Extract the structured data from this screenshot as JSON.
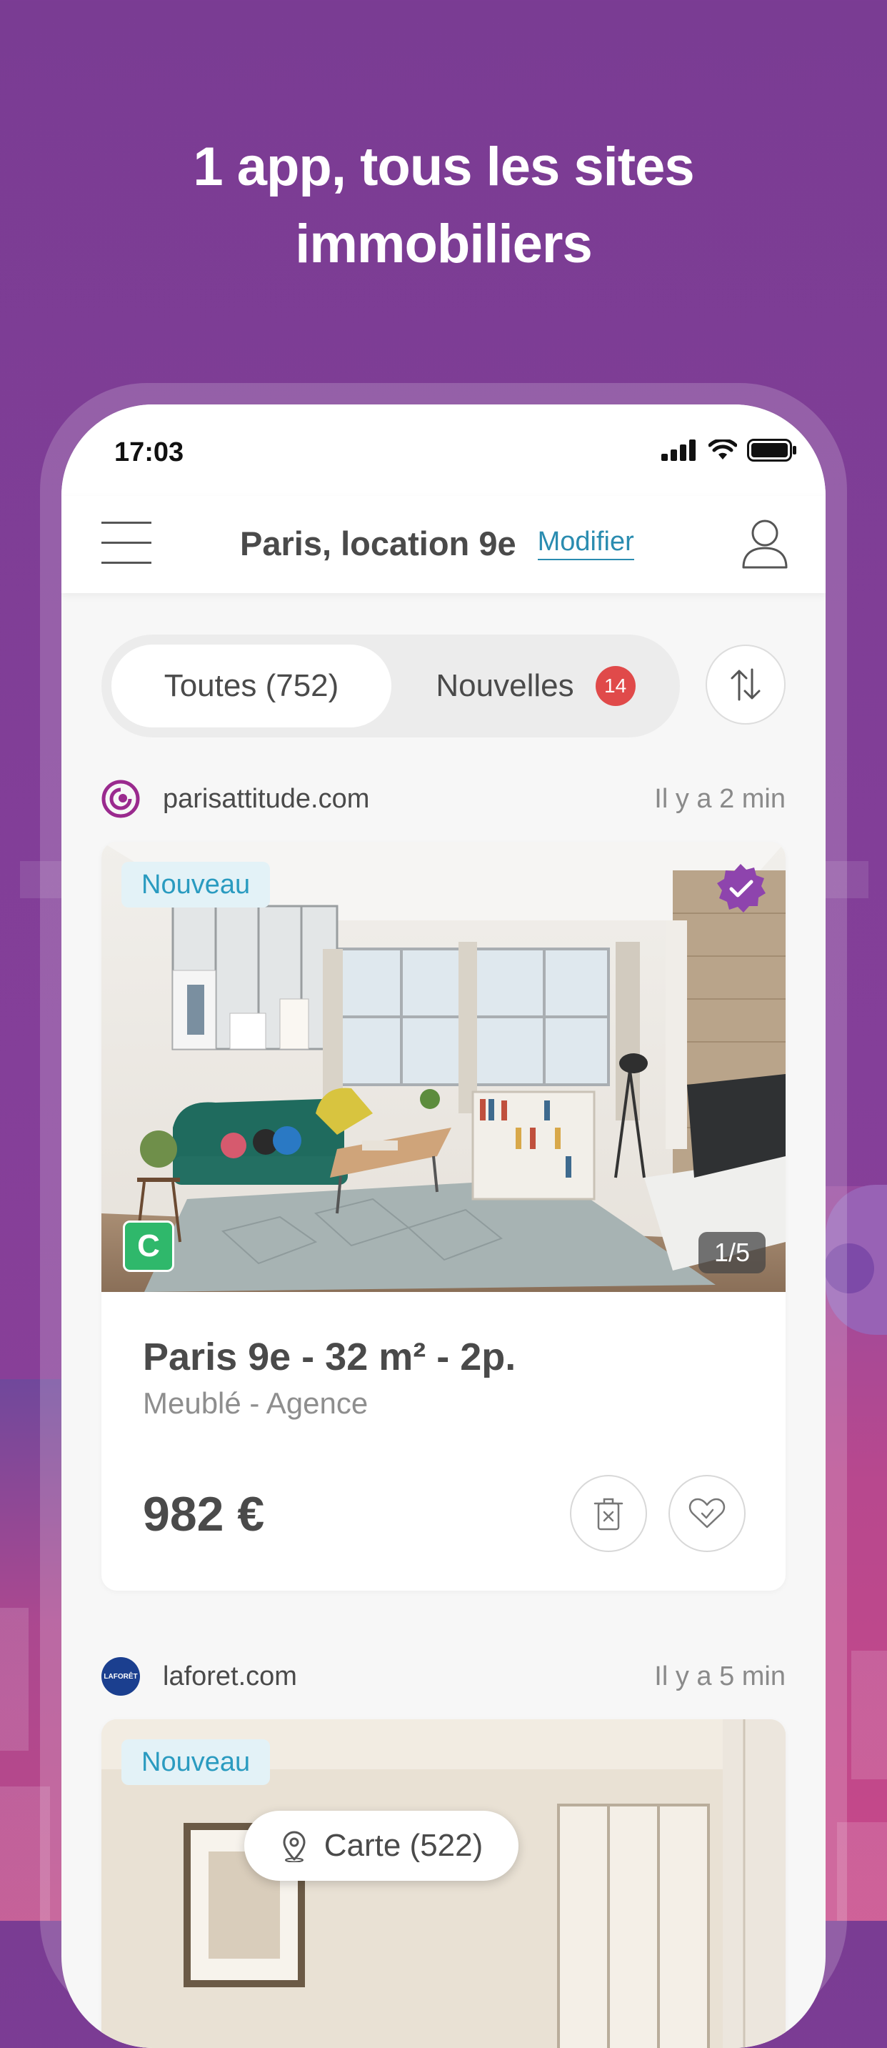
{
  "headline": "1 app, tous les sites\nimmobiliers",
  "status_bar": {
    "time": "17:03"
  },
  "app_bar": {
    "title": "Paris, location 9e",
    "modify_label": "Modifier"
  },
  "tabs": {
    "all_label": "Toutes (752)",
    "new_label": "Nouvelles",
    "new_count": "14"
  },
  "listings": [
    {
      "source": "parisattitude.com",
      "time_ago": "Il y a 2 min",
      "tag": "Nouveau",
      "energy_class": "C",
      "photo_counter": "1/5",
      "title": "Paris 9e - 32 m² - 2p.",
      "subtitle": "Meublé - Agence",
      "price": "982 €",
      "verified": true
    },
    {
      "source": "laforet.com",
      "time_ago": "Il y a 5 min",
      "tag": "Nouveau",
      "source_logo_text": "LAFORÊT"
    }
  ],
  "map_button": {
    "label": "Carte (522)"
  },
  "colors": {
    "background": "#7a3c93",
    "accent_link": "#2a8cb0",
    "badge_red": "#e04a4a",
    "energy_green": "#2fb86b",
    "verified_purple": "#8e44ad",
    "tag_bg": "#e3f2f7"
  },
  "icons": [
    "menu-icon",
    "user-icon",
    "sort-icon",
    "cellular-icon",
    "wifi-icon",
    "battery-icon",
    "verified-icon",
    "trash-icon",
    "heart-icon",
    "map-pin-icon"
  ]
}
